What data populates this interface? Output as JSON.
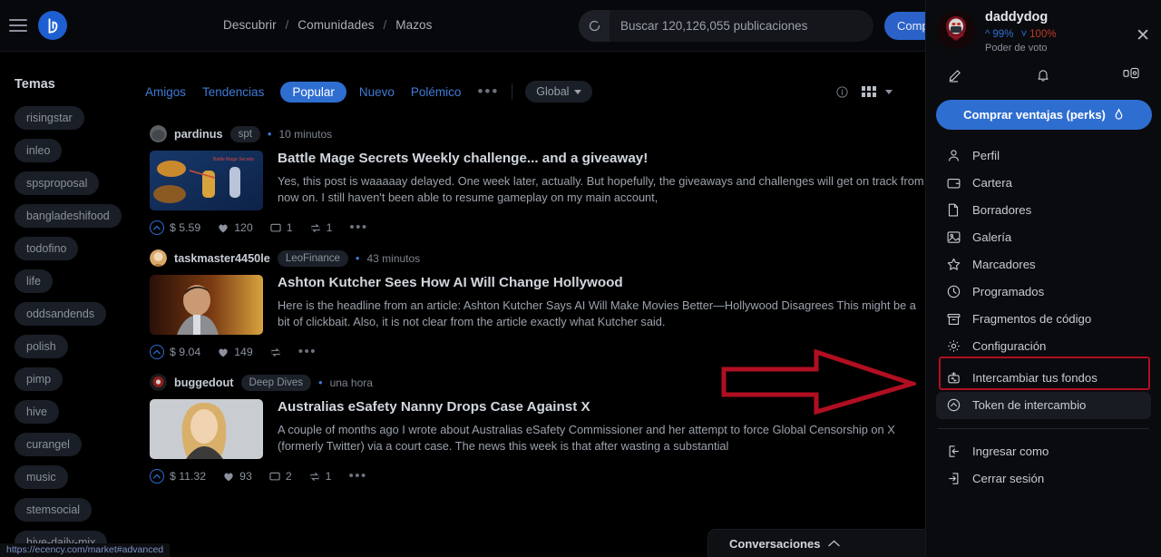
{
  "topbar": {
    "menu_icon": "hamburger-icon",
    "logo_icon": "ecency-logo",
    "breadcrumb": [
      "Descubrir",
      "Comunidades",
      "Mazos"
    ],
    "breadcrumb_separator": "/",
    "search_placeholder": "Buscar 120,126,055 publicaciones",
    "search_value": "",
    "buy_button": "Comprar"
  },
  "sidebar": {
    "title": "Temas",
    "topics": [
      "risingstar",
      "inleo",
      "spsproposal",
      "bangladeshifood",
      "todofino",
      "life",
      "oddsandends",
      "polish",
      "pimp",
      "hive",
      "curangel",
      "music",
      "stemsocial",
      "hive-daily-mix"
    ]
  },
  "filters": {
    "tabs": [
      {
        "label": "Amigos",
        "active": false
      },
      {
        "label": "Tendencias",
        "active": false
      },
      {
        "label": "Popular",
        "active": true
      },
      {
        "label": "Nuevo",
        "active": false
      },
      {
        "label": "Polémico",
        "active": false
      }
    ],
    "more": "•••",
    "scope_select": "Global",
    "info_icon": "info-icon",
    "layout_icon": "grid-layout-icon"
  },
  "feed": {
    "posts": [
      {
        "author": "pardinus",
        "community": "spt",
        "time": "10 minutos",
        "title": "Battle Mage Secrets Weekly challenge... and a giveaway!",
        "excerpt": "Yes, this post is waaaaay delayed. One week later, actually. But hopefully, the giveaways and challenges will get on track from now on. I still haven't been able to resume gameplay on my main account,",
        "payout": "$ 5.59",
        "votes": "120",
        "comments": "1",
        "reblogs": "1",
        "more": "•••"
      },
      {
        "author": "taskmaster4450le",
        "community": "LeoFinance",
        "time": "43 minutos",
        "title": "Ashton Kutcher Sees How AI Will Change Hollywood",
        "excerpt": "Here is the headline from an article: Ashton Kutcher Says AI Will Make Movies Better—Hollywood Disagrees This might be a bit of clickbait. Also, it is not clear from the article exactly what Kutcher said.",
        "payout": "$ 9.04",
        "votes": "149",
        "comments": "",
        "reblogs": "",
        "more": "•••"
      },
      {
        "author": "buggedout",
        "community": "Deep Dives",
        "time": "una hora",
        "title": "Australias eSafety Nanny Drops Case Against X",
        "excerpt": "A couple of months ago I wrote about Australias eSafety Commissioner and her attempt to force Global Censorship on X (formerly Twitter) via a court case. The news this week is that after wasting a substantial",
        "payout": "$ 11.32",
        "votes": "93",
        "comments": "2",
        "reblogs": "1",
        "more": "•••"
      }
    ]
  },
  "user_panel": {
    "username": "daddydog",
    "vote_up_pct": "99%",
    "vote_down_pct": "100%",
    "vote_label": "Poder de voto",
    "close_icon": "close-icon",
    "quick_icons": [
      "edit-pencil-icon",
      "bell-icon",
      "chat-support-icon"
    ],
    "perks_button": "Comprar ventajas (perks)",
    "perks_icon": "flame-icon",
    "menu": [
      {
        "label": "Perfil",
        "icon": "user-icon",
        "highlight": false,
        "hover": false
      },
      {
        "label": "Cartera",
        "icon": "wallet-icon",
        "highlight": false,
        "hover": false
      },
      {
        "label": "Borradores",
        "icon": "file-icon",
        "highlight": false,
        "hover": false
      },
      {
        "label": "Galería",
        "icon": "image-icon",
        "highlight": false,
        "hover": false
      },
      {
        "label": "Marcadores",
        "icon": "star-icon",
        "highlight": false,
        "hover": false
      },
      {
        "label": "Programados",
        "icon": "clock-icon",
        "highlight": false,
        "hover": false
      },
      {
        "label": "Fragmentos de código",
        "icon": "snippets-icon",
        "highlight": false,
        "hover": false
      },
      {
        "label": "Configuración",
        "icon": "gear-icon",
        "highlight": false,
        "hover": false
      }
    ],
    "menu_group2": [
      {
        "label": "Intercambiar tus fondos",
        "icon": "swap-funds-icon",
        "highlight": true,
        "hover": false
      },
      {
        "label": "Token de intercambio",
        "icon": "swap-token-icon",
        "highlight": false,
        "hover": true
      }
    ],
    "menu_group3": [
      {
        "label": "Ingresar como",
        "icon": "login-as-icon",
        "highlight": false,
        "hover": false
      },
      {
        "label": "Cerrar sesión",
        "icon": "logout-icon",
        "highlight": false,
        "hover": false
      }
    ]
  },
  "conversations": {
    "title": "Conversaciones",
    "chevron": "chevron-up-icon"
  },
  "statusbar": {
    "url": "https://ecency.com/market#advanced"
  },
  "annotation": {
    "arrow_color": "#b00f21",
    "highlight_color": "#b00f21"
  },
  "colors": {
    "accent_blue": "#2f6ed1",
    "link_blue": "#3f7ad6",
    "bg": "#000000",
    "panel_bg": "#0a0b0e",
    "chip_bg": "#1a1e26",
    "down_red": "#c0392b"
  }
}
